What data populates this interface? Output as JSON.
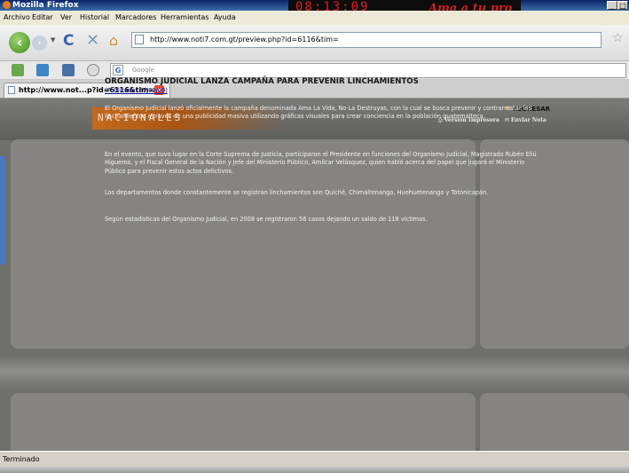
{
  "window": {
    "title": "Mozilla Firefox",
    "minimize": "_",
    "restore": "□"
  },
  "banner": {
    "clock": "08:13:09",
    "slogan": "Ama a tu pro"
  },
  "menu": [
    "Archivo",
    "Editar",
    "Ver",
    "Historial",
    "Marcadores",
    "Herramientas",
    "Ayuda"
  ],
  "nav": {
    "url": "http://www.noti7.com.gt/preview.php?id=6116&tim="
  },
  "search": {
    "placeholder": "Google"
  },
  "tab": {
    "label": "http://www.not...p?id=6116&tim="
  },
  "page": {
    "section": "NACIONALES",
    "back_label": "REGRESAR",
    "print_label": "Versión Impresora",
    "send_label": "Enviar Nota",
    "headline": "ORGANISMO JUDICIAL LANZA CAMPAÑA PARA PREVENIR LINCHAMIENTOS",
    "published": "(Publicado: 27/02/09)",
    "paragraphs": [
      "El Organismo Judicial lanzó oficialmente la campaña denominada Ama La Vida, No La Destruyas, con la cual se busca prevenir y contrarrestar los linchamientos a través de una publicidad masiva utilizando gráficas visuales para crear conciencia en la población guatemalteca.",
      "En el evento, que tuvo lugar en la Corte Suprema de Justicia, participaron el Presidente en funciones del Organismo Judicial, Magistrado Rubén Eliú Higueros, y el Fiscal General de la Nación y Jefe del Ministerio Público, Amílcar Velásquez, quien habló acerca del papel que jugará el Ministerio Público para prevenir estos actos delictivos.",
      "Los departamentos donde constantemente se registran linchamientos son Quiché, Chimaltenango, Huehuetenango y Totonicapán.",
      "Según estadísticas del Organismo Judicial, en 2008 se registraron 56 casos dejando un saldo de 118 víctimas."
    ]
  },
  "status": {
    "text": "Terminado"
  },
  "colors": {
    "accent_orange": "#c46a1e",
    "page_bg": "#6f6f6c",
    "panel_bg": "#858481"
  }
}
